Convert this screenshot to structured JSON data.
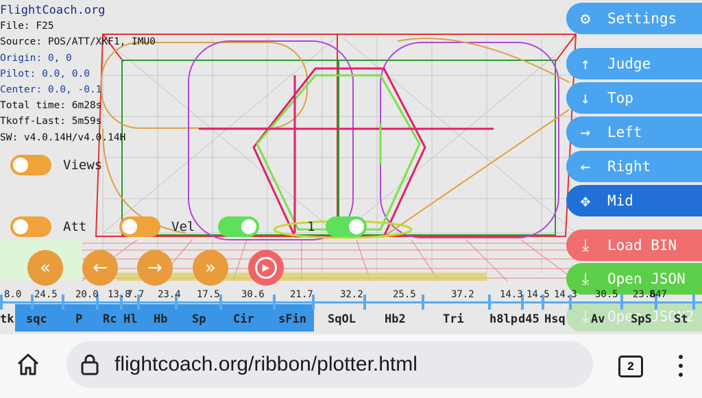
{
  "info": {
    "title": "FlightCoach.org",
    "file": "File: F25",
    "source": "Source: POS/ATT/XKF1, IMU0",
    "origin": "Origin: 0, 0",
    "pilot": "Pilot: 0.0, 0.0",
    "center": "Center: 0.0, -0.1",
    "total_time": "Total time: 6m28s",
    "tkoff_last": "Tkoff-Last: 5m59s",
    "sw": "SW: v4.0.14H/v4.0.14H"
  },
  "toggles": {
    "views_label": "Views",
    "att_label": "Att",
    "vel_label": "Vel",
    "one_label": "1"
  },
  "side_buttons": {
    "settings": "Settings",
    "judge": "Judge",
    "top": "Top",
    "left": "Left",
    "right": "Right",
    "mid": "Mid",
    "load_bin": "Load BIN",
    "open_json": "Open JSON",
    "open_json2": "Open JSON2"
  },
  "icons": {
    "settings": "gear-icon",
    "judge": "arrow-up-icon",
    "top": "arrow-down-icon",
    "left": "arrow-right-icon",
    "right": "arrow-left-icon",
    "mid": "move-icon",
    "load_bin": "download-icon",
    "open_json": "download-icon",
    "rewind": "double-chevron-left-icon",
    "back": "arrow-left-icon",
    "forward": "arrow-right-icon",
    "fastforward": "double-chevron-right-icon",
    "play": "play-icon"
  },
  "timeline": {
    "scores": [
      "8.0",
      "24.5",
      "20.0",
      "13.8",
      "7.7",
      "23.4",
      "17.5",
      "30.6",
      "21.7",
      "32.2",
      "25.5",
      "37.2",
      "14.3",
      "14.5",
      "14.3",
      "30.5",
      "23.6",
      "8",
      "47"
    ],
    "maneuvers": [
      "tk",
      "sqc",
      "P",
      "Rc",
      "Hl",
      "Hb",
      "Sp",
      "Cir",
      "sFin",
      "SqOL",
      "Hb2",
      "Tri",
      "h8lp",
      "d45",
      "Hsq",
      "Av",
      "SpS",
      "St"
    ]
  },
  "browser": {
    "url": "flightcoach.org/ribbon/plotter.html",
    "tab_count": "2"
  },
  "colors": {
    "accent_blue": "#4aa4f0",
    "active_blue": "#2070d8",
    "orange": "#e89c3c",
    "red": "#f06e6e",
    "green": "#5ccf48"
  }
}
